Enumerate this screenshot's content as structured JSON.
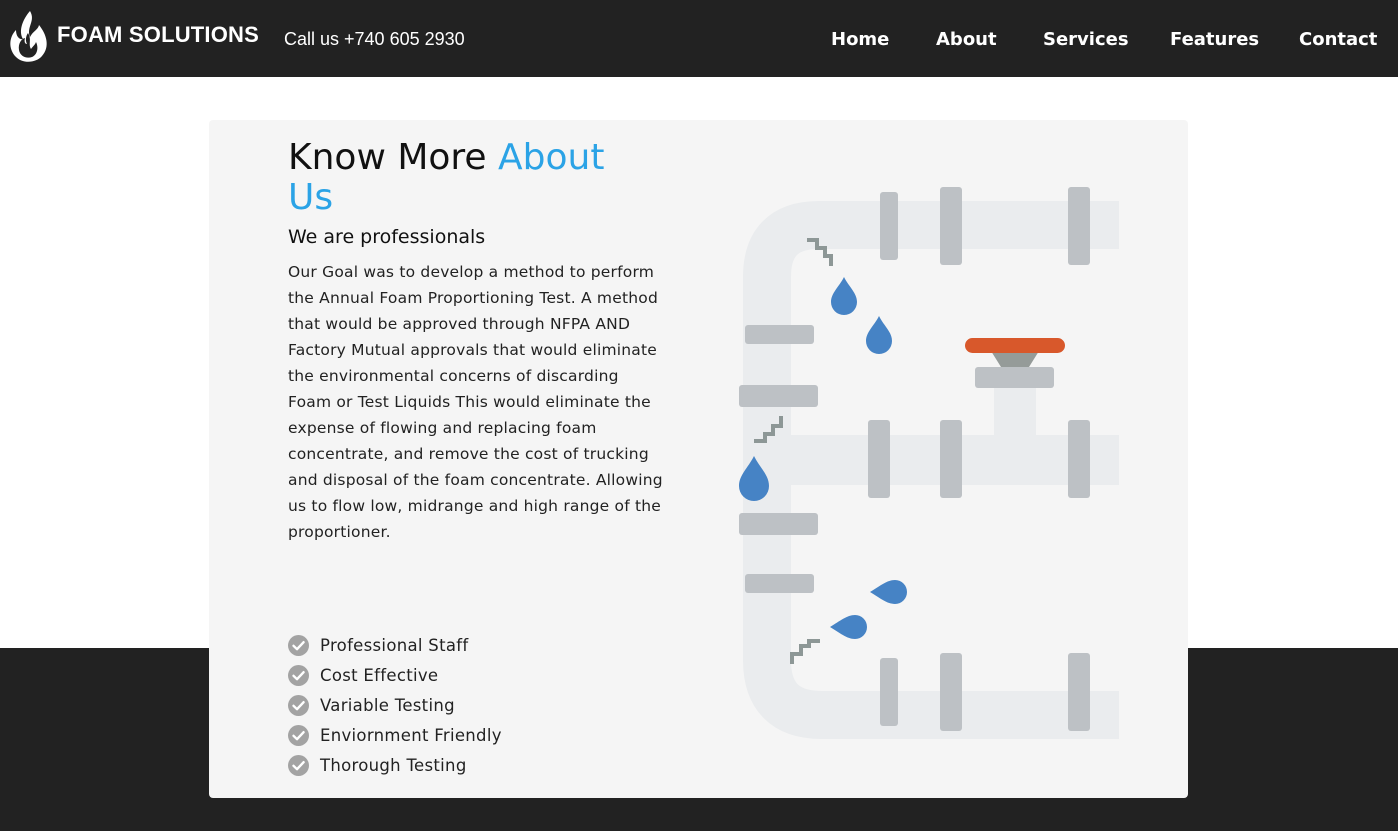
{
  "header": {
    "brand": "FOAM SOLUTIONS",
    "phone": "Call us +740 605 2930",
    "nav": [
      "Home",
      "About",
      "Services",
      "Features",
      "Contact"
    ],
    "logo_icon": "flame-logo-icon"
  },
  "about": {
    "title_part1": "Know More ",
    "title_accent": "About Us",
    "subtitle": "We are professionals",
    "body": "Our Goal was to develop a method to perform the Annual Foam Proportioning Test. A method that would be approved through NFPA AND Factory Mutual approvals that would eliminate the environmental concerns of discarding Foam or Test Liquids This would eliminate the expense of flowing and replacing foam concentrate, and remove the cost of trucking and disposal of the foam concentrate. Allowing us to flow low, midrange and high range of the proportioner.",
    "features": [
      "Professional Staff",
      "Cost Effective",
      "Variable Testing",
      "Enviornment Friendly",
      "Thorough Testing"
    ],
    "feature_icon": "check-circle-icon",
    "illustration": "leaking-pipes-illustration"
  },
  "colors": {
    "header_bg": "#222222",
    "accent": "#2ba3e6",
    "card_bg": "#f5f5f5",
    "check": "#a3a3a3",
    "drop": "#4683c5",
    "valve_handle": "#d8582b",
    "pipe": "#eaecee",
    "pipe_ring": "#bdc1c5"
  }
}
